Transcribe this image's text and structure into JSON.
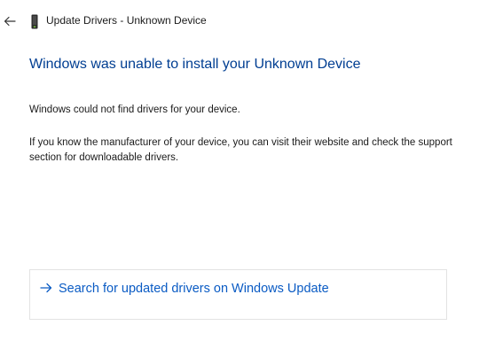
{
  "window": {
    "title": "Update Drivers - Unknown Device",
    "back_icon": "back-arrow-icon",
    "device_icon": "device-icon"
  },
  "content": {
    "heading": "Windows was unable to install your Unknown Device",
    "paragraph1": "Windows could not find drivers for your device.",
    "paragraph2": "If you know the manufacturer of your device, you can visit their website and check the support section for downloadable drivers."
  },
  "action": {
    "label": "Search for updated drivers on Windows Update",
    "icon": "arrow-right-icon"
  },
  "colors": {
    "heading": "#003e92",
    "link": "#0a5bc4",
    "border": "#e3e3e3"
  }
}
